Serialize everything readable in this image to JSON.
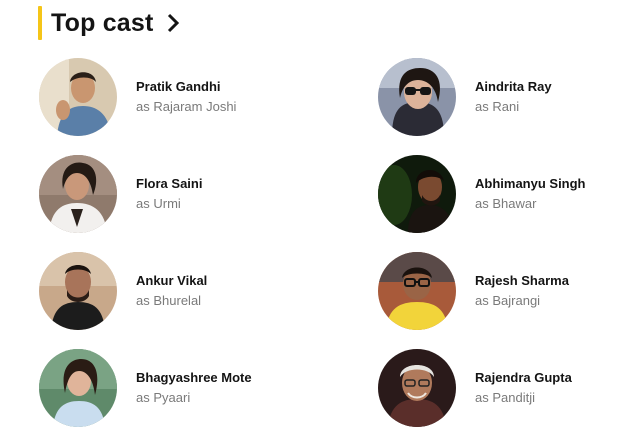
{
  "header": {
    "title": "Top cast",
    "accent_color": "#f5c518",
    "chevron_icon": "chevron-right-icon"
  },
  "cast": [
    {
      "name": "Pratik Gandhi",
      "as": "as",
      "character": "Rajaram Joshi"
    },
    {
      "name": "Aindrita Ray",
      "as": "as",
      "character": "Rani"
    },
    {
      "name": "Flora Saini",
      "as": "as",
      "character": "Urmi"
    },
    {
      "name": "Abhimanyu Singh",
      "as": "as",
      "character": "Bhawar"
    },
    {
      "name": "Ankur Vikal",
      "as": "as",
      "character": "Bhurelal"
    },
    {
      "name": "Rajesh Sharma",
      "as": "as",
      "character": "Bajrangi"
    },
    {
      "name": "Bhagyashree Mote",
      "as": "as",
      "character": "Pyaari"
    },
    {
      "name": "Rajendra Gupta",
      "as": "as",
      "character": "Panditji"
    }
  ]
}
